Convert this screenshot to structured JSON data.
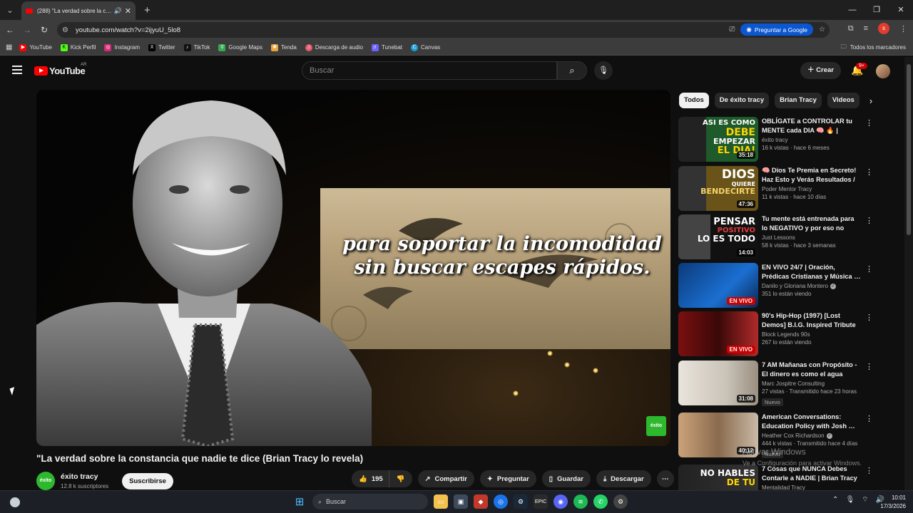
{
  "browser": {
    "tab_title": "(288) \"La verdad sobre la c…",
    "url": "youtube.com/watch?v=2ijyuU_5lo8",
    "ask_google": "Preguntar a Google",
    "profile_initial": "s",
    "bookmarks": [
      "YouTube",
      "Kick Perfil",
      "Instagram",
      "Twitter",
      "TikTok",
      "Google Maps",
      "Tenda",
      "Descarga de audio",
      "Tunebat",
      "Canvas"
    ],
    "all_bookmarks": "Todos los marcadores"
  },
  "masthead": {
    "logo": "YouTube",
    "country": "AR",
    "search_placeholder": "Buscar",
    "create": "Crear",
    "notifications": "9+"
  },
  "video": {
    "subtitle_line1": "para soportar la incomodidad",
    "subtitle_line2": "sin buscar escapes rápidos.",
    "watermark": "éxito",
    "title": "\"La verdad sobre la constancia que nadie te dice (Brian Tracy lo revela)",
    "channel": "éxito tracy",
    "channel_avatar": "éxito",
    "subscribers": "12.8 k suscriptores",
    "subscribe": "Suscribirse",
    "likes": "195",
    "share": "Compartir",
    "ask": "Preguntar",
    "save": "Guardar",
    "download": "Descargar"
  },
  "chips": [
    "Todos",
    "De éxito tracy",
    "Brian Tracy",
    "Videos"
  ],
  "recommendations": [
    {
      "title": "OBLÍGATE a CONTROLAR tu MENTE cada DIA 🧠 🔥 | Brian…",
      "channel": "éxito tracy",
      "views": "16 k vistas · hace 6 meses",
      "duration": "35:18",
      "thumb_text": "ASI ES COMO\nDEBE\nEMPEZAR\nEL DIA!"
    },
    {
      "title": "🧠 Dios Te Premia en Secreto! Haz Esto y Verás Resultados / …",
      "channel": "Poder Mentor Tracy",
      "views": "11 k vistas · hace 10 días",
      "duration": "47:36",
      "thumb_text": "DIOS\nQUIERE\nBENDECIRTE"
    },
    {
      "title": "Tu mente está entrenada para lo NEGATIVO y por eso no avanz…",
      "channel": "Just Lessons",
      "views": "58 k vistas · hace 3 semanas",
      "duration": "14:03",
      "thumb_text": "PENSAR\nPOSITIVO\nLO ES TODO"
    },
    {
      "title": "EN VIVO 24/7 | Oración, Prédicas Cristianas y Música …",
      "channel": "Danilo y Gloriana Montero",
      "views": "351 lo están viendo",
      "live": "EN VIVO"
    },
    {
      "title": "90's Hip-Hop (1997) [Lost Demos] B.I.G. Inspired Tribute …",
      "channel": "Block Legends 90s",
      "views": "267 lo están viendo",
      "live": "EN VIVO"
    },
    {
      "title": "7 AM Mañanas con Propósito - El dinero es como el agua",
      "channel": "Marc Jospitre Consulting",
      "views": "27 vistas · Transmitido hace 23 horas",
      "duration": "31:08",
      "badge": "Nuevo"
    },
    {
      "title": "American Conversations: Education Policy with Josh …",
      "channel": "Heather Cox Richardson",
      "views": "444 k vistas · Transmitido hace 4 días",
      "duration": "40:12",
      "badge": "Nuevo"
    },
    {
      "title": "7 Cosas que NUNCA Debes Contarle a NADIE | Brian Tracy",
      "channel": "Mentalidad Tracy",
      "views": "",
      "thumb_text": "NO HABLES\nDE TU"
    }
  ],
  "activate_windows": {
    "title": "Activar Windows",
    "sub": "Ve a Configuración para activar Windows."
  },
  "taskbar": {
    "search": "Buscar",
    "time": "10:01",
    "date": "17/3/2026"
  }
}
